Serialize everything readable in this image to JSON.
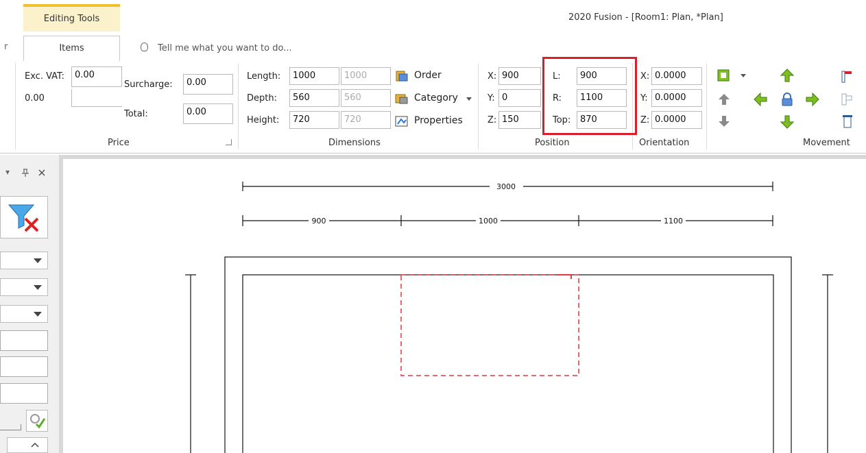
{
  "window": {
    "context_tab": "Editing Tools",
    "title": "2020 Fusion - [Room1: Plan, *Plan]"
  },
  "tabs": {
    "items": "Items",
    "tell_me": "Tell me what you want to do...",
    "left_mark": "r"
  },
  "price": {
    "group": "Price",
    "exc_vat_label": "Exc. VAT:",
    "exc_vat_value": "0.00",
    "sub_value": "0.00",
    "surcharge_label": "Surcharge:",
    "surcharge_value": "0.00",
    "total_label": "Total:",
    "total_value": "0.00"
  },
  "dimensions": {
    "group": "Dimensions",
    "length_label": "Length:",
    "length_value": "1000",
    "length_default": "1000",
    "depth_label": "Depth:",
    "depth_value": "560",
    "depth_default": "560",
    "height_label": "Height:",
    "height_value": "720",
    "height_default": "720",
    "order_label": "Order",
    "category_label": "Category",
    "properties_label": "Properties"
  },
  "position": {
    "group": "Position",
    "x_label": "X:",
    "x_value": "900",
    "y_label": "Y:",
    "y_value": "0",
    "z_label": "Z:",
    "z_value": "150",
    "l_label": "L:",
    "l_value": "900",
    "r_label": "R:",
    "r_value": "1100",
    "top_label": "Top:",
    "top_value": "870"
  },
  "orientation": {
    "group": "Orientation",
    "x_label": "X:",
    "x_value": "0.0000",
    "y_label": "Y:",
    "y_value": "0.0000",
    "z_label": "Z:",
    "z_value": "0.0000"
  },
  "movement": {
    "group": "Movement"
  },
  "plan": {
    "total_dim": "3000",
    "seg1": "900",
    "seg2": "1000",
    "seg3": "1100"
  },
  "colors": {
    "accent_tab": "#f0c030",
    "highlight": "#d9202a",
    "arrow_green": "#7cbf1e",
    "arrow_grey": "#8a8a8a"
  }
}
